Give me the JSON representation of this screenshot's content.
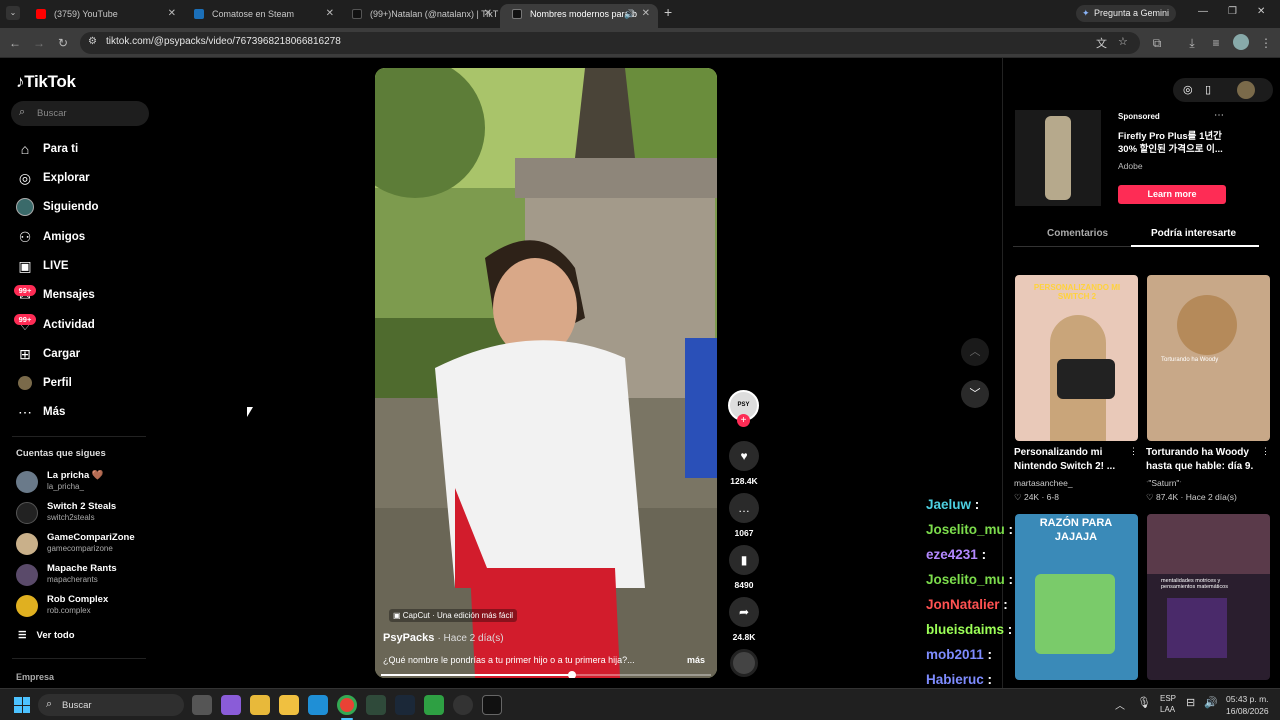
{
  "browser": {
    "tabs": [
      {
        "label": "(3759) YouTube",
        "color": "#ff0000"
      },
      {
        "label": "Comatose en Steam",
        "color": "#1b4d8c"
      },
      {
        "label": "(99+)Natalan (@natalanx) | TikT",
        "color": "#222"
      },
      {
        "label": "Nombres modernos para b",
        "color": "#222"
      }
    ],
    "gemini_label": "Pregunta a Gemini",
    "url": "tiktok.com/@psypacks/video/7673968218066816278"
  },
  "sidebar": {
    "logo": "TikTok",
    "search_placeholder": "Buscar",
    "nav": [
      {
        "label": "Para ti",
        "icon": "home-icon"
      },
      {
        "label": "Explorar",
        "icon": "compass-icon"
      },
      {
        "label": "Siguiendo",
        "icon": "following-avatar-icon"
      },
      {
        "label": "Amigos",
        "icon": "friends-icon"
      },
      {
        "label": "LIVE",
        "icon": "live-icon"
      },
      {
        "label": "Mensajes",
        "icon": "messages-icon"
      },
      {
        "label": "Actividad",
        "icon": "activity-icon"
      },
      {
        "label": "Cargar",
        "icon": "upload-icon"
      },
      {
        "label": "Perfil",
        "icon": "profile-icon"
      },
      {
        "label": "Más",
        "icon": "more-icon"
      }
    ],
    "badge": "99+",
    "following_title": "Cuentas que sigues",
    "following": [
      {
        "name": "La pricha 🤎",
        "handle": "la_pricha_",
        "color": "#6a7a8a"
      },
      {
        "name": "Switch 2 Steals",
        "handle": "switch2steals",
        "color": "#222"
      },
      {
        "name": "GameCompariZone",
        "handle": "gamecomparizone",
        "color": "#c9b08a"
      },
      {
        "name": "Mapache Rants",
        "handle": "mapacherants",
        "color": "#5a4a6a"
      },
      {
        "name": "Rob Complex",
        "handle": "rob.complex",
        "color": "#e0b020"
      }
    ],
    "see_all": "Ver todo",
    "footer": "Empresa"
  },
  "video": {
    "watermark": "CapCut · Una edición más fácil",
    "author": "PsyPacks",
    "time": "· Hace 2 día(s)",
    "caption": "¿Qué nombre le pondrías a tu primer hijo o a tu primera hija?...",
    "more": "más",
    "progress": 0.58,
    "likes": "128.4K",
    "comments": "1067",
    "saves": "8490",
    "shares": "24.8K"
  },
  "right_panel": {
    "ad": {
      "sponsored": "Sponsored",
      "title": "Firefly Pro Plus를 1년간 30% 할인된 가격으로 이...",
      "brand": "Adobe",
      "cta": "Learn more"
    },
    "tabs": [
      "Comentarios",
      "Podría interesarte"
    ],
    "cards": [
      {
        "title": "Personalizando mi Nintendo Switch 2! ...",
        "author": "martasanchee_",
        "meta": "♡ 24K · 6-8",
        "overlay": "PERSONALIZANDO MI SWITCH 2"
      },
      {
        "title": "Torturando ha Woody hasta que hable: día 9.",
        "author": "ˑ\"Saturn\"ˑ",
        "meta": "♡ 87.4K · Hace 2 día(s)",
        "overlay": "Torturando ha Woody"
      },
      {
        "title": "",
        "author": "",
        "meta": "",
        "overlay": "RAZÓN PARA JAJAJA"
      },
      {
        "title": "",
        "author": "",
        "meta": "",
        "overlay": "mentalidades motrices y pensamientos matemáticos"
      }
    ]
  },
  "chat": [
    {
      "user": "Jaeluw",
      "color": "#4dd0e1"
    },
    {
      "user": "Joselito_mu",
      "color": "#7cdc4c"
    },
    {
      "user": "eze4231",
      "color": "#b388ff"
    },
    {
      "user": "Joselito_mu",
      "color": "#7cdc4c"
    },
    {
      "user": "JonNatalier",
      "color": "#ff5252"
    },
    {
      "user": "blueisdaims",
      "color": "#9cff57"
    },
    {
      "user": "mob2011",
      "color": "#7e8cff"
    },
    {
      "user": "Habieruc",
      "color": "#7e8cff"
    },
    {
      "user": "blueisdaims",
      "color": "#9cff57"
    }
  ],
  "taskbar": {
    "search": "Buscar",
    "lang": "ESP",
    "layout": "LAA",
    "time": "05:43 p. m.",
    "date": "16/08/2026"
  }
}
